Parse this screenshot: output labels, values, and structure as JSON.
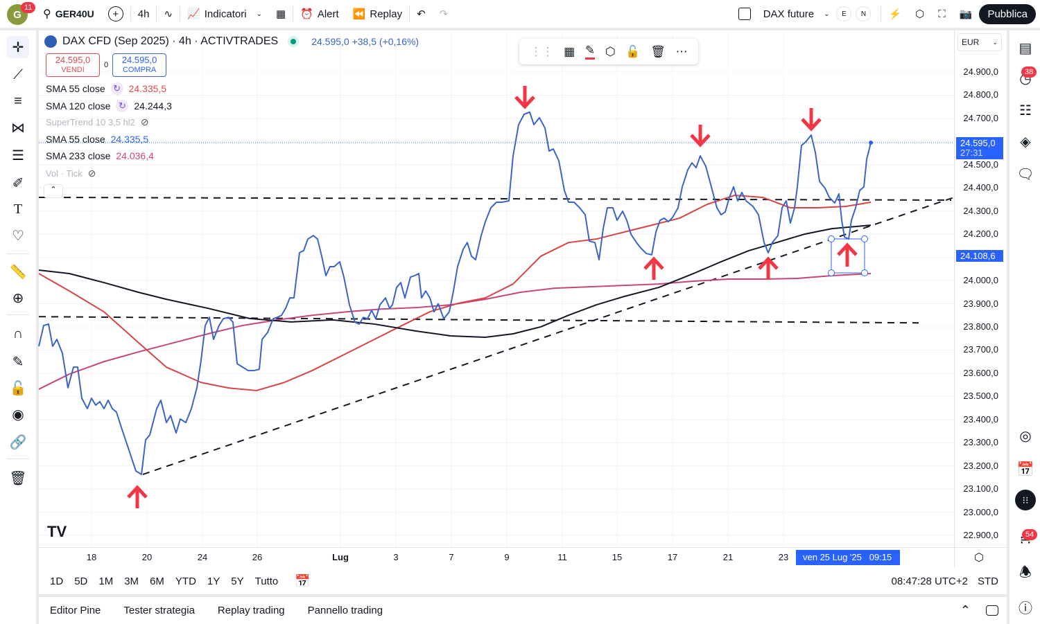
{
  "topbar": {
    "avatar_letter": "G",
    "avatar_badge": "11",
    "symbol": "GER40U",
    "interval": "4h",
    "indicators": "Indicatori",
    "alert": "Alert",
    "replay": "Replay",
    "layout_name": "DAX future",
    "e_badge": "E",
    "n_badge": "N",
    "publish": "Pubblica"
  },
  "legend": {
    "title": "DAX CFD (Sep 2025) · 4h · ACTIVTRADES",
    "quote": "24.595,0 +38,5 (+0,16%)",
    "sell_price": "24.595,0",
    "sell_label": "VENDI",
    "spread": "0",
    "buy_price": "24.595,0",
    "buy_label": "COMPRA",
    "indicators": [
      {
        "name": "SMA 55 close",
        "value": "24.335,5",
        "color": "#e04a4a"
      },
      {
        "name": "SMA 120 close",
        "value": "24.244,3",
        "color": "#131722"
      },
      {
        "name": "SuperTrend 10 3,5 hl2",
        "value": "",
        "color": "#b2b5be"
      },
      {
        "name": "SMA 55 close",
        "value": "24.335,5",
        "color": "#2962ff"
      },
      {
        "name": "SMA 233 close",
        "value": "24.036,4",
        "color": "#d0447a"
      },
      {
        "name": "Vol · Tick",
        "value": "",
        "color": "#b2b5be"
      }
    ]
  },
  "price_scale": {
    "currency": "EUR",
    "ticks": [
      "24.900,0",
      "24.800,0",
      "24.700,0",
      "24.600,0",
      "24.500,0",
      "24.400,0",
      "24.300,0",
      "24.200,0",
      "24.100,0",
      "24.000,0",
      "23.900,0",
      "23.800,0",
      "23.700,0",
      "23.600,0",
      "23.500,0",
      "23.400,0",
      "23.300,0",
      "23.200,0",
      "23.100,0",
      "23.000,0",
      "22.900,0"
    ],
    "last_price": "24.595,0",
    "countdown": "27:31",
    "crosshair_price": "24.108,6"
  },
  "time_scale": {
    "labels": [
      "18",
      "20",
      "24",
      "26",
      "Lug",
      "3",
      "7",
      "9",
      "11",
      "15",
      "17",
      "21",
      "23"
    ],
    "crosshair_time": "ven 25 Lug '25   09:15"
  },
  "range_bar": {
    "ranges": [
      "1D",
      "5D",
      "1M",
      "3M",
      "6M",
      "YTD",
      "1Y",
      "5Y",
      "Tutto"
    ],
    "clock": "08:47:28 UTC+2",
    "session": "STD"
  },
  "bottom_bar": {
    "tabs": [
      "Editor Pine",
      "Tester strategia",
      "Replay trading",
      "Pannello trading"
    ]
  },
  "right_toolbar": {
    "alerts_badge": "38",
    "news_badge": "54"
  },
  "colors": {
    "price": "#3a63c9",
    "sma55": "#d84343",
    "sma120": "#131722",
    "sma233": "#c8457a",
    "accent": "#2962ff",
    "arrow": "#f23645"
  },
  "chart_data": {
    "type": "line",
    "x_unit": "bar index",
    "ylim": [
      22850,
      24980
    ],
    "series": [
      {
        "name": "DAX CFD close",
        "color": "#3a63c9",
        "points": [
          [
            0,
            23716
          ],
          [
            3.5,
            23806
          ],
          [
            7,
            23812
          ],
          [
            10,
            23716
          ],
          [
            13,
            23746
          ],
          [
            17,
            23686
          ],
          [
            21,
            23537
          ],
          [
            25,
            23626
          ],
          [
            28,
            23626
          ],
          [
            31,
            23492
          ],
          [
            35,
            23447
          ],
          [
            38,
            23492
          ],
          [
            41,
            23462
          ],
          [
            44,
            23477
          ],
          [
            47,
            23447
          ],
          [
            50,
            23483
          ],
          [
            53,
            23447
          ],
          [
            56,
            23432
          ],
          [
            60,
            23357
          ],
          [
            65,
            23268
          ],
          [
            70,
            23178
          ],
          [
            74,
            23163
          ],
          [
            77,
            23312
          ],
          [
            80,
            23333
          ],
          [
            85,
            23447
          ],
          [
            88,
            23483
          ],
          [
            92,
            23387
          ],
          [
            95,
            23417
          ],
          [
            99,
            23342
          ],
          [
            102,
            23402
          ],
          [
            106,
            23387
          ],
          [
            110,
            23447
          ],
          [
            114,
            23537
          ],
          [
            117,
            23656
          ],
          [
            120,
            23806
          ],
          [
            123,
            23841
          ],
          [
            126,
            23746
          ],
          [
            130,
            23806
          ],
          [
            133,
            23835
          ],
          [
            137,
            23841
          ],
          [
            140,
            23820
          ],
          [
            143,
            23641
          ],
          [
            147,
            23626
          ],
          [
            151,
            23611
          ],
          [
            155,
            23611
          ],
          [
            159,
            23617
          ],
          [
            161,
            23746
          ],
          [
            165,
            23776
          ],
          [
            169,
            23835
          ],
          [
            172,
            23841
          ],
          [
            175,
            23850
          ],
          [
            178,
            23880
          ],
          [
            181,
            23925
          ],
          [
            184,
            23925
          ],
          [
            188,
            24120
          ],
          [
            191,
            24129
          ],
          [
            194,
            24179
          ],
          [
            198,
            24194
          ],
          [
            201,
            24179
          ],
          [
            204,
            24105
          ],
          [
            207,
            24021
          ],
          [
            210,
            24060
          ],
          [
            213,
            24060
          ],
          [
            217,
            24081
          ],
          [
            220,
            24015
          ],
          [
            224,
            23895
          ],
          [
            228,
            23820
          ],
          [
            231,
            23812
          ],
          [
            234,
            23841
          ],
          [
            237,
            23835
          ],
          [
            240,
            23871
          ],
          [
            243,
            23835
          ],
          [
            246,
            23895
          ],
          [
            250,
            23925
          ],
          [
            253,
            23880
          ],
          [
            255,
            23895
          ],
          [
            258,
            23970
          ],
          [
            261,
            23991
          ],
          [
            264,
            23925
          ],
          [
            268,
            24015
          ],
          [
            271,
            24021
          ],
          [
            274,
            24030
          ],
          [
            276,
            23925
          ],
          [
            279,
            23955
          ],
          [
            282,
            23925
          ],
          [
            285,
            23865
          ],
          [
            288,
            23900
          ],
          [
            292,
            23835
          ],
          [
            296,
            23865
          ],
          [
            299,
            23955
          ],
          [
            302,
            24060
          ],
          [
            306,
            24135
          ],
          [
            309,
            24164
          ],
          [
            312,
            24105
          ],
          [
            315,
            24090
          ],
          [
            319,
            24194
          ],
          [
            322,
            24254
          ],
          [
            326,
            24314
          ],
          [
            330,
            24338
          ],
          [
            334,
            24338
          ],
          [
            339,
            24344
          ],
          [
            342,
            24538
          ],
          [
            346,
            24673
          ],
          [
            350,
            24718
          ],
          [
            354,
            24727
          ],
          [
            357,
            24673
          ],
          [
            361,
            24703
          ],
          [
            365,
            24658
          ],
          [
            368,
            24559
          ],
          [
            371,
            24568
          ],
          [
            375,
            24517
          ],
          [
            379,
            24389
          ],
          [
            382,
            24338
          ],
          [
            386,
            24338
          ],
          [
            390,
            24314
          ],
          [
            394,
            24284
          ],
          [
            397,
            24170
          ],
          [
            401,
            24164
          ],
          [
            404,
            24090
          ],
          [
            407,
            24224
          ],
          [
            410,
            24314
          ],
          [
            414,
            24314
          ],
          [
            417,
            24260
          ],
          [
            421,
            24299
          ],
          [
            424,
            24260
          ],
          [
            427,
            24200
          ],
          [
            431,
            24164
          ],
          [
            434,
            24141
          ],
          [
            438,
            24117
          ],
          [
            442,
            24111
          ],
          [
            445,
            24209
          ],
          [
            448,
            24260
          ],
          [
            451,
            24269
          ],
          [
            454,
            24254
          ],
          [
            457,
            24272
          ],
          [
            461,
            24314
          ],
          [
            464,
            24404
          ],
          [
            468,
            24478
          ],
          [
            471,
            24508
          ],
          [
            474,
            24487
          ],
          [
            477,
            24538
          ],
          [
            481,
            24493
          ],
          [
            485,
            24404
          ],
          [
            489,
            24314
          ],
          [
            492,
            24284
          ],
          [
            495,
            24296
          ],
          [
            498,
            24359
          ],
          [
            501,
            24404
          ],
          [
            504,
            24344
          ],
          [
            507,
            24380
          ],
          [
            510,
            24344
          ],
          [
            515,
            24320
          ],
          [
            519,
            24284
          ],
          [
            523,
            24164
          ],
          [
            526,
            24120
          ],
          [
            529,
            24164
          ],
          [
            533,
            24194
          ],
          [
            536,
            24314
          ],
          [
            539,
            24344
          ],
          [
            542,
            24248
          ],
          [
            545,
            24314
          ],
          [
            547,
            24404
          ],
          [
            550,
            24583
          ],
          [
            553,
            24598
          ],
          [
            557,
            24628
          ],
          [
            560,
            24553
          ],
          [
            563,
            24428
          ],
          [
            567,
            24398
          ],
          [
            570,
            24359
          ],
          [
            574,
            24335
          ],
          [
            577,
            24374
          ],
          [
            579,
            24260
          ],
          [
            581,
            24188
          ],
          [
            584,
            24179
          ],
          [
            586,
            24260
          ],
          [
            589,
            24314
          ],
          [
            592,
            24389
          ],
          [
            595,
            24404
          ],
          [
            597,
            24523
          ],
          [
            600,
            24595
          ]
        ]
      },
      {
        "name": "SMA 120 close",
        "color": "#131722",
        "points": [
          [
            0,
            24045
          ],
          [
            22,
            24030
          ],
          [
            47,
            23991
          ],
          [
            72,
            23949
          ],
          [
            92,
            23919
          ],
          [
            122,
            23880
          ],
          [
            152,
            23836
          ],
          [
            182,
            23821
          ],
          [
            212,
            23830
          ],
          [
            242,
            23812
          ],
          [
            272,
            23782
          ],
          [
            297,
            23761
          ],
          [
            322,
            23755
          ],
          [
            342,
            23770
          ],
          [
            362,
            23800
          ],
          [
            382,
            23850
          ],
          [
            402,
            23895
          ],
          [
            422,
            23931
          ],
          [
            447,
            23970
          ],
          [
            472,
            24030
          ],
          [
            492,
            24081
          ],
          [
            512,
            24129
          ],
          [
            532,
            24164
          ],
          [
            552,
            24200
          ],
          [
            572,
            24224
          ],
          [
            600,
            24239
          ]
        ]
      },
      {
        "name": "SMA 55 close",
        "color": "#d84343",
        "points": [
          [
            0,
            24030
          ],
          [
            22,
            23955
          ],
          [
            47,
            23865
          ],
          [
            72,
            23731
          ],
          [
            92,
            23626
          ],
          [
            117,
            23560
          ],
          [
            137,
            23536
          ],
          [
            157,
            23525
          ],
          [
            177,
            23560
          ],
          [
            197,
            23611
          ],
          [
            222,
            23686
          ],
          [
            242,
            23746
          ],
          [
            262,
            23806
          ],
          [
            282,
            23865
          ],
          [
            302,
            23901
          ],
          [
            322,
            23925
          ],
          [
            342,
            23985
          ],
          [
            362,
            24105
          ],
          [
            382,
            24164
          ],
          [
            402,
            24179
          ],
          [
            422,
            24209
          ],
          [
            442,
            24239
          ],
          [
            462,
            24269
          ],
          [
            482,
            24329
          ],
          [
            502,
            24368
          ],
          [
            522,
            24359
          ],
          [
            542,
            24314
          ],
          [
            562,
            24314
          ],
          [
            582,
            24320
          ],
          [
            600,
            24338
          ]
        ]
      },
      {
        "name": "SMA 233 close",
        "color": "#c8457a",
        "points": [
          [
            0,
            23531
          ],
          [
            22,
            23596
          ],
          [
            47,
            23650
          ],
          [
            72,
            23692
          ],
          [
            97,
            23731
          ],
          [
            122,
            23770
          ],
          [
            147,
            23806
          ],
          [
            172,
            23830
          ],
          [
            197,
            23850
          ],
          [
            222,
            23865
          ],
          [
            247,
            23877
          ],
          [
            272,
            23883
          ],
          [
            297,
            23895
          ],
          [
            322,
            23919
          ],
          [
            347,
            23949
          ],
          [
            372,
            23967
          ],
          [
            397,
            23973
          ],
          [
            422,
            23979
          ],
          [
            447,
            23985
          ],
          [
            472,
            23997
          ],
          [
            497,
            24006
          ],
          [
            522,
            24006
          ],
          [
            547,
            24009
          ],
          [
            572,
            24021
          ],
          [
            600,
            24030
          ]
        ]
      }
    ],
    "drawings": {
      "resistance": 24359,
      "support": 23844,
      "trendline": [
        [
          75,
          23163
        ],
        [
          660,
          24359
        ]
      ]
    }
  }
}
